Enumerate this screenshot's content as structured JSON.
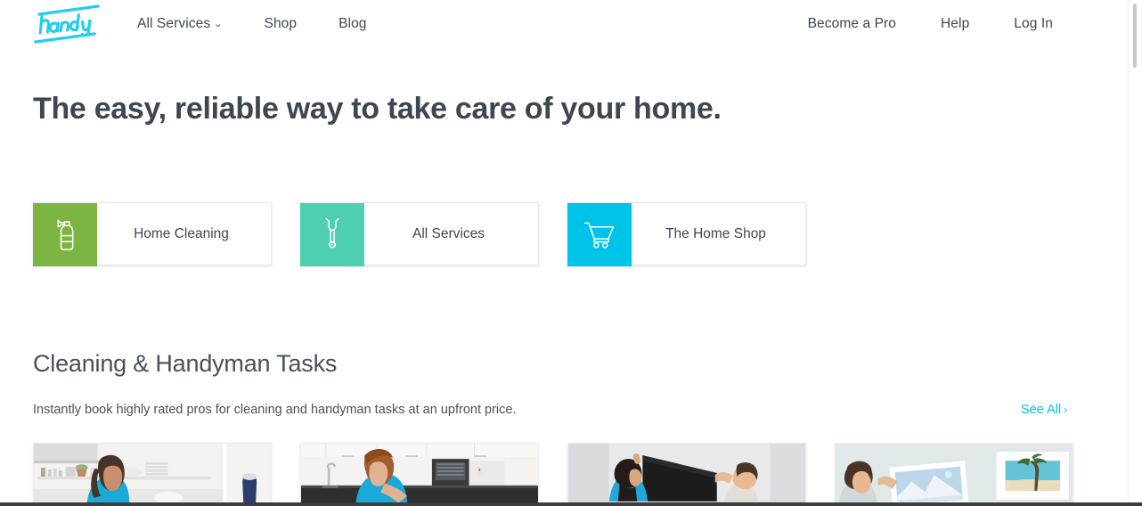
{
  "brand": {
    "logo_text": "handy",
    "logo_color": "#22cdf0"
  },
  "header": {
    "nav_left": [
      {
        "label": "All Services",
        "has_caret": true,
        "caret": "⌄"
      },
      {
        "label": "Shop",
        "has_caret": false
      },
      {
        "label": "Blog",
        "has_caret": false
      }
    ],
    "nav_right": [
      {
        "label": "Become a Pro"
      },
      {
        "label": "Help"
      },
      {
        "label": "Log In"
      }
    ]
  },
  "hero": {
    "title": "The easy, reliable way to take care of your home."
  },
  "quick_cards": [
    {
      "label": "Home Cleaning",
      "icon": "spray-bottle-icon",
      "tile_color": "#7cb542"
    },
    {
      "label": "All Services",
      "icon": "wrench-icon",
      "tile_color": "#4ecfb2"
    },
    {
      "label": "The Home Shop",
      "icon": "shopping-cart-icon",
      "tile_color": "#00c3ea"
    }
  ],
  "section": {
    "title": "Cleaning & Handyman Tasks",
    "subtitle": "Instantly book highly rated pros for cleaning and handyman tasks at an upfront price.",
    "see_all_label": "See All",
    "see_all_chevron": "›",
    "see_all_color": "#00c3ea"
  },
  "task_cards": [
    {
      "photo": "woman-cleaning-kitchen-photo",
      "alt": "Woman in blue shirt cleaning a white kitchen with open shelving"
    },
    {
      "photo": "man-cleaning-counter-photo",
      "alt": "Man in blue t-shirt wiping a dark kitchen counter"
    },
    {
      "photo": "two-men-mounting-tv-photo",
      "alt": "Two men lifting a large flat-screen TV against a gray wall"
    },
    {
      "photo": "man-hanging-pictures-photo",
      "alt": "Man hanging framed beach photographs on a pale wall"
    }
  ],
  "scrollbar": {
    "name": "vertical-scrollbar"
  }
}
